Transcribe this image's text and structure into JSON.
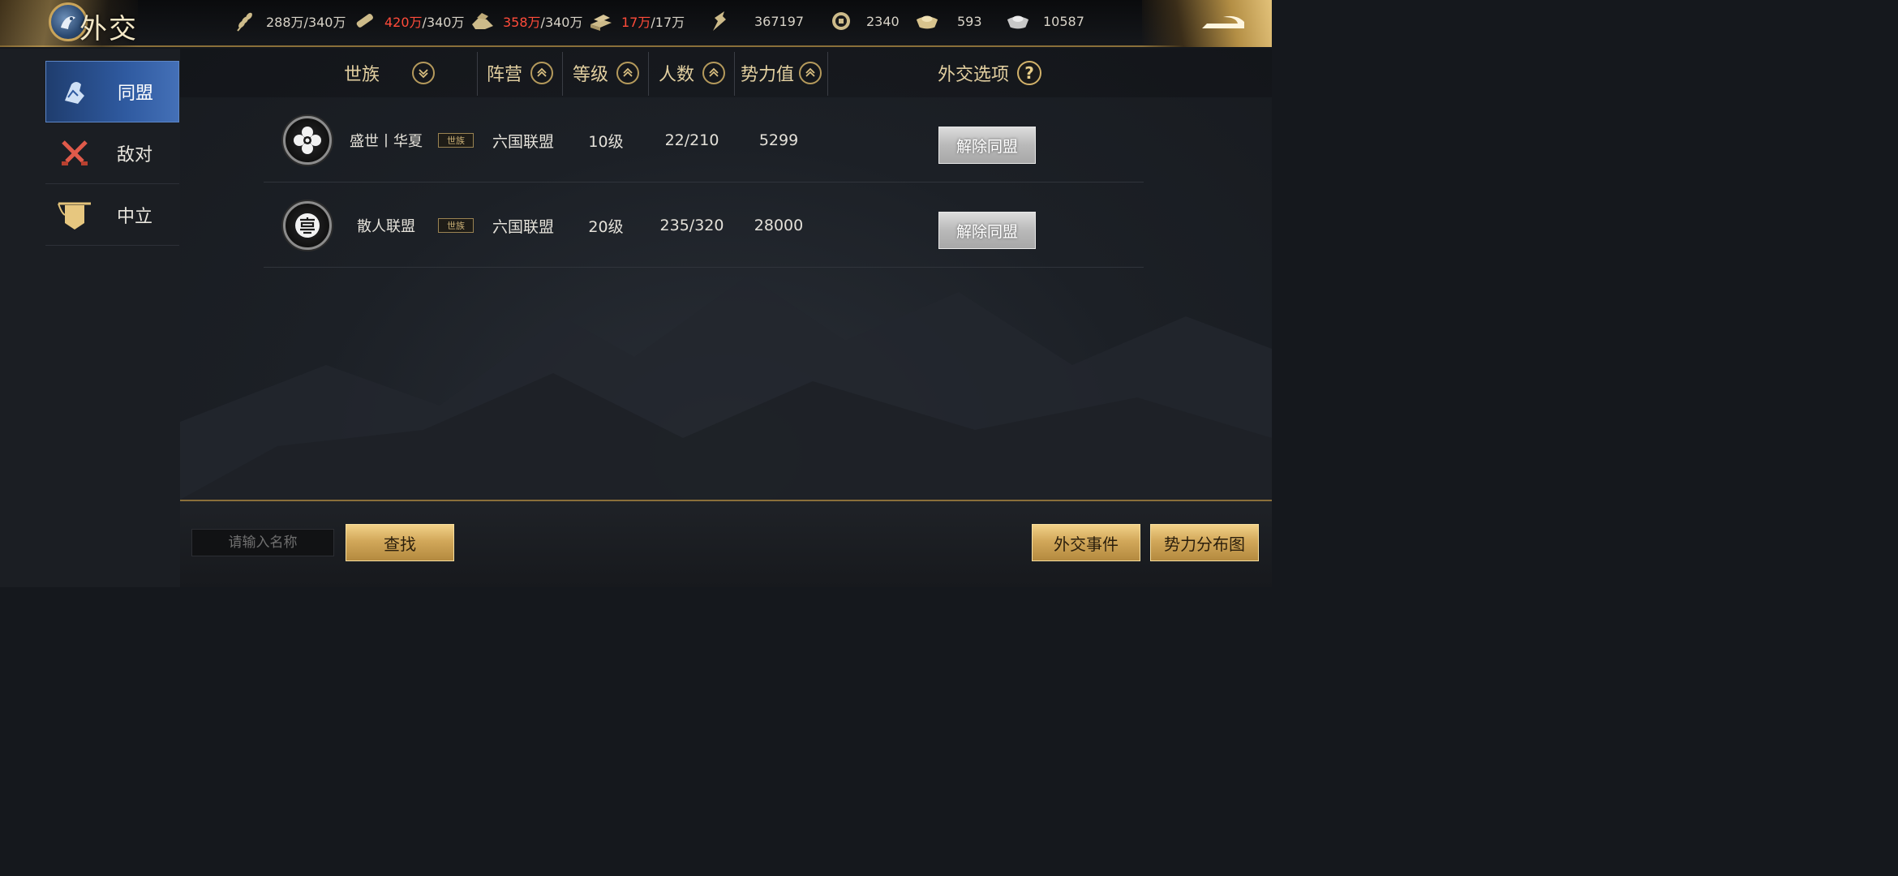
{
  "header": {
    "title": "外交",
    "resources": [
      {
        "icon": "grain-icon",
        "current": "288万",
        "max": "/340万",
        "over": false
      },
      {
        "icon": "wood-icon",
        "current": "420万",
        "max": "/340万",
        "over": true
      },
      {
        "icon": "stone-icon",
        "current": "358万",
        "max": "/340万",
        "over": true
      },
      {
        "icon": "iron-icon",
        "current": "17万",
        "max": "/17万",
        "over": true
      },
      {
        "icon": "decree-icon",
        "current": "367197",
        "max": "",
        "over": false
      },
      {
        "icon": "copper-coin-icon",
        "current": "2340",
        "max": "",
        "over": false
      },
      {
        "icon": "gold-ingot-icon",
        "current": "593",
        "max": "",
        "over": false
      },
      {
        "icon": "silver-ingot-icon",
        "current": "10587",
        "max": "",
        "over": false
      }
    ]
  },
  "sidebar": {
    "items": [
      {
        "label": "同盟",
        "icon": "alliance-icon",
        "active": true
      },
      {
        "label": "敌对",
        "icon": "crossed-swords-icon",
        "active": false
      },
      {
        "label": "中立",
        "icon": "banner-icon",
        "active": false
      }
    ]
  },
  "table": {
    "columns": {
      "clan": "世族",
      "faction": "阵营",
      "level": "等级",
      "members": "人数",
      "power": "势力值",
      "options": "外交选项"
    },
    "help": "?",
    "rows": [
      {
        "name": "盛世丨华夏",
        "tag": "世族",
        "faction": "六国联盟",
        "level": "10级",
        "members": "22/210",
        "power": "5299",
        "action": "解除同盟"
      },
      {
        "name": "散人联盟",
        "tag": "世族",
        "faction": "六国联盟",
        "level": "20级",
        "members": "235/320",
        "power": "28000",
        "action": "解除同盟"
      }
    ]
  },
  "footer": {
    "search_placeholder": "请输入名称",
    "search_button": "查找",
    "events_button": "外交事件",
    "map_button": "势力分布图"
  },
  "colors": {
    "accent_gold": "#d2a85a",
    "active_tab": "#2f5aa0",
    "over_capacity": "#ff4b3a"
  }
}
